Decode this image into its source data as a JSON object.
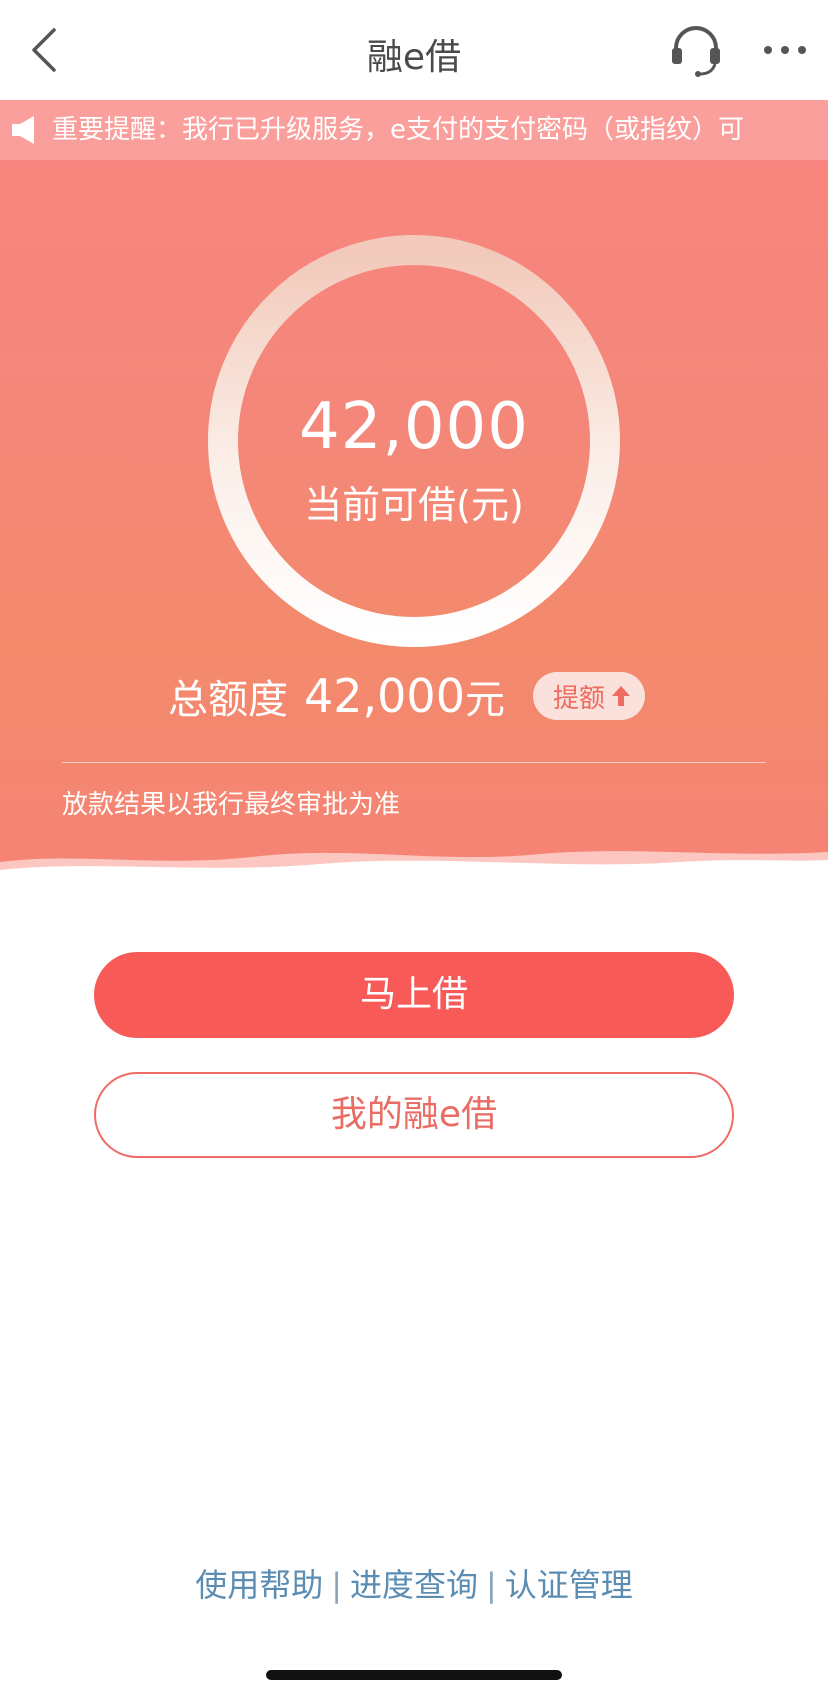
{
  "nav": {
    "title": "融e借",
    "back_icon": "chevron-left-icon",
    "service_icon": "headset-icon",
    "more_icon": "ellipsis-icon"
  },
  "notice": {
    "icon": "speaker-icon",
    "text": "重要提醒：我行已升级服务，e支付的支付密码（或指纹）可"
  },
  "credit": {
    "available_amount": "42,000",
    "available_label": "当前可借(元)",
    "total_label": "总额度",
    "total_amount": "42,000",
    "total_unit": "元",
    "raise_label": "提额",
    "raise_icon": "arrow-up-icon"
  },
  "disclaimer": "放款结果以我行最终审批为准",
  "buttons": {
    "borrow": "马上借",
    "my_loans": "我的融e借"
  },
  "footer": {
    "help": "使用帮助",
    "separator": "|",
    "progress": "进度查询",
    "auth": "认证管理"
  },
  "colors": {
    "accent": "#f75a57",
    "hero_top": "#f98580",
    "hero_mid": "#f38a6c",
    "link": "#5b8db3"
  }
}
